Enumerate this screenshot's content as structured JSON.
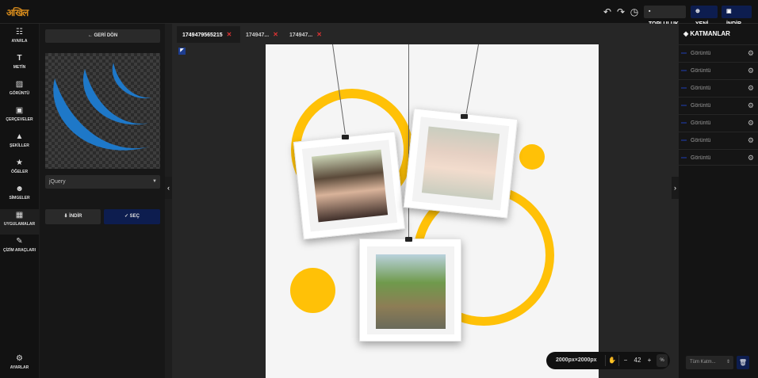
{
  "app": {
    "logo_text": "अखिल"
  },
  "toolbar": {
    "undo_icon": "undo-icon",
    "redo_icon": "redo-icon",
    "history_icon": "history-icon",
    "community_label": "TOPLULUK",
    "new_label": "YENİ",
    "download_label": "İNDİR"
  },
  "nav": {
    "items": [
      {
        "label": "AYARLA",
        "icon": "sliders-icon"
      },
      {
        "label": "METİN",
        "icon": "text-icon"
      },
      {
        "label": "GÖRÜNTÜ",
        "icon": "image-icon"
      },
      {
        "label": "ÇERÇEVELER",
        "icon": "frame-icon"
      },
      {
        "label": "ŞEKİLLER",
        "icon": "shapes-icon"
      },
      {
        "label": "ÖĞELER",
        "icon": "star-icon"
      },
      {
        "label": "SİMGELER",
        "icon": "smiley-icon"
      },
      {
        "label": "UYGULAMALAR",
        "icon": "grid-icon"
      },
      {
        "label": "ÇİZİM ARAÇLARI",
        "icon": "brush-icon"
      }
    ],
    "settings_label": "AYARLAR"
  },
  "panel": {
    "back_label": "GERİ DÖN",
    "select_value": "jQuery",
    "download_label": "İNDİR",
    "select_label": "SEÇ"
  },
  "tabs": [
    {
      "label": "1749479565215"
    },
    {
      "label": "174947..."
    },
    {
      "label": "174947..."
    }
  ],
  "zoom": {
    "canvas_size": "2000px×2000px",
    "minus": "−",
    "value": "42",
    "plus": "+",
    "percent": "%"
  },
  "layers": {
    "title": "KATMANLAR",
    "items": [
      {
        "label": "Görüntü"
      },
      {
        "label": "Görüntü"
      },
      {
        "label": "Görüntü"
      },
      {
        "label": "Görüntü"
      },
      {
        "label": "Görüntü"
      },
      {
        "label": "Görüntü"
      },
      {
        "label": "Görüntü"
      }
    ],
    "filter_value": "Tüm Katm..."
  },
  "colors": {
    "accent_yellow": "#ffc107",
    "jquery_blue": "#1e78c8",
    "primary_button": "#0d1d4f",
    "close_red": "#dd3333"
  }
}
